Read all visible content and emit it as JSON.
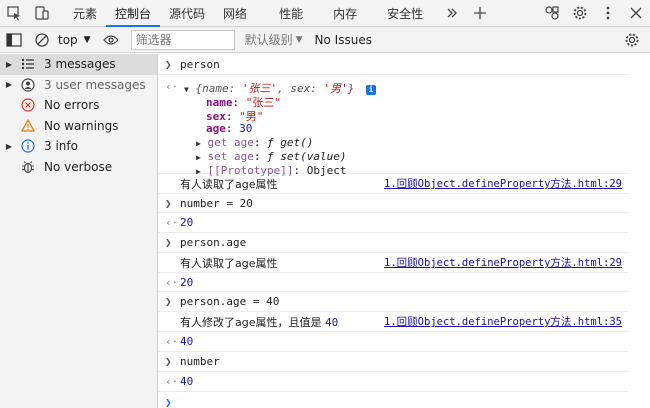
{
  "tabs": [
    {
      "label": "元素"
    },
    {
      "label": "控制台"
    },
    {
      "label": "源代码"
    },
    {
      "label": "网络"
    },
    {
      "label": "性能"
    },
    {
      "label": "内存"
    },
    {
      "label": "安全性"
    }
  ],
  "active_tab": "控制台",
  "toolbar": {
    "context": "top",
    "filter_placeholder": "筛选器",
    "levels": "默认级别",
    "issues": "No Issues"
  },
  "sidebar": {
    "items": [
      {
        "label": "3 messages",
        "icon": "list-icon",
        "expandable": true
      },
      {
        "label": "3 user messages",
        "icon": "user-icon",
        "expandable": true
      },
      {
        "label": "No errors",
        "icon": "error-icon",
        "expandable": false
      },
      {
        "label": "No warnings",
        "icon": "warning-icon",
        "expandable": false
      },
      {
        "label": "3 info",
        "icon": "info-icon",
        "expandable": true
      },
      {
        "label": "No verbose",
        "icon": "bug-icon",
        "expandable": false
      }
    ]
  },
  "console": {
    "input1": "person",
    "obj_summary": {
      "open": "{",
      "k1": "name: ",
      "v1": "'张三'",
      "sep": ", ",
      "k2": "sex: ",
      "v2": "'男'",
      "close": "}"
    },
    "props": {
      "name_key": "name",
      "name_val": "\"张三\"",
      "sex_key": "sex",
      "sex_val": "\"男\"",
      "age_key": "age",
      "age_val": "30",
      "get_age_key": "get age",
      "get_age_val": "ƒ get()",
      "set_age_key": "set age",
      "set_age_val": "ƒ set(value)",
      "proto_key": "[[Prototype]]",
      "proto_val": "Object"
    },
    "log1": {
      "text": "有人读取了age属性",
      "source": "1.回顾Object.defineProperty方法.html:29"
    },
    "input2": "number = 20",
    "output2": "20",
    "input3": "person.age",
    "log2": {
      "text": "有人读取了age属性",
      "source": "1.回顾Object.defineProperty方法.html:29"
    },
    "output3": "20",
    "input4": "person.age = 40",
    "log3": {
      "text": "有人修改了age属性，且值是",
      "value": "40",
      "source": "1.回顾Object.defineProperty方法.html:35"
    },
    "output4": "40",
    "input5": "number",
    "output5": "40"
  },
  "colors": {
    "accent": "#1a73e8",
    "string": "#c41a16",
    "number": "#1a1aa6",
    "key": "#881280",
    "link": "#1a0dab"
  }
}
